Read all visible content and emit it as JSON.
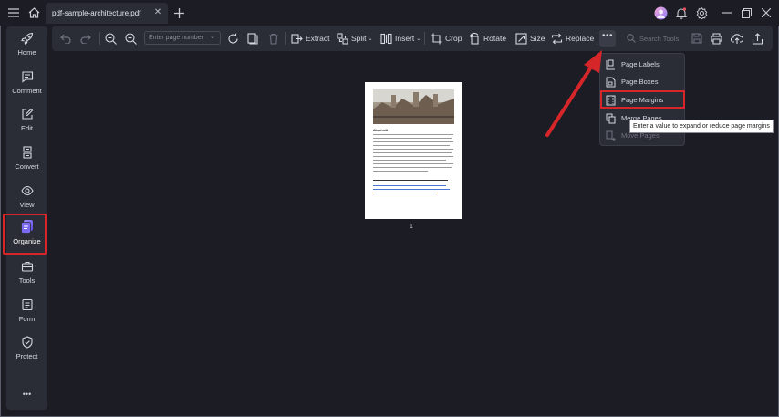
{
  "titlebar": {
    "tab_title": "pdf-sample-architecture.pdf",
    "icons": [
      "menu-icon",
      "home-icon",
      "close-icon",
      "plus-icon",
      "avatar",
      "bell-icon",
      "gear-icon",
      "minimize-icon",
      "restore-icon",
      "window-close-icon"
    ]
  },
  "sidebar": {
    "items": [
      {
        "label": "Home",
        "icon": "rocket-icon"
      },
      {
        "label": "Comment",
        "icon": "comment-icon"
      },
      {
        "label": "Edit",
        "icon": "edit-icon"
      },
      {
        "label": "Convert",
        "icon": "convert-icon"
      },
      {
        "label": "View",
        "icon": "eye-icon"
      },
      {
        "label": "Organize",
        "icon": "organize-icon"
      },
      {
        "label": "Tools",
        "icon": "toolbox-icon"
      },
      {
        "label": "Form",
        "icon": "form-icon"
      },
      {
        "label": "Protect",
        "icon": "shield-icon"
      }
    ],
    "more": "•••"
  },
  "toolbar": {
    "page_placeholder": "Enter page number",
    "extract": "Extract",
    "split": "Split",
    "insert": "Insert",
    "crop": "Crop",
    "rotate": "Rotate",
    "size": "Size",
    "replace": "Replace",
    "more": "•••",
    "search_placeholder": "Search Tools"
  },
  "document": {
    "page_number": "1",
    "heading": "Abschnitt"
  },
  "menu": {
    "items": [
      {
        "label": "Page Labels",
        "icon": "page-labels-icon",
        "enabled": true
      },
      {
        "label": "Page Boxes",
        "icon": "page-boxes-icon",
        "enabled": true
      },
      {
        "label": "Page Margins",
        "icon": "page-margins-icon",
        "enabled": true
      },
      {
        "label": "Merge Pages",
        "icon": "merge-pages-icon",
        "enabled": true
      },
      {
        "label": "Move Pages",
        "icon": "move-pages-icon",
        "enabled": false
      }
    ],
    "tooltip": "Enter a value to expand or reduce page margins"
  },
  "colors": {
    "background": "#1c1d24",
    "panel": "#2b2d36",
    "highlight": "#d7262a",
    "accent": "#6c5ce7"
  }
}
